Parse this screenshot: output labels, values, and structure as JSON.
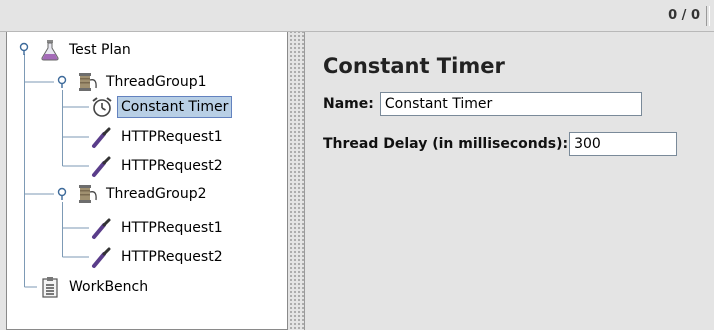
{
  "toolbar": {
    "counter": "0 / 0"
  },
  "tree": {
    "nodes": [
      {
        "label": "Test Plan",
        "icon": "flask-icon"
      },
      {
        "label": "ThreadGroup1",
        "icon": "spool-icon"
      },
      {
        "label": "Constant Timer",
        "icon": "timer-icon",
        "selected": true
      },
      {
        "label": "HTTPRequest1",
        "icon": "pipette-icon"
      },
      {
        "label": "HTTPRequest2",
        "icon": "pipette-icon"
      },
      {
        "label": "ThreadGroup2",
        "icon": "spool-icon"
      },
      {
        "label": "HTTPRequest1",
        "icon": "pipette-icon"
      },
      {
        "label": "HTTPRequest2",
        "icon": "pipette-icon"
      },
      {
        "label": "WorkBench",
        "icon": "clipboard-icon"
      }
    ]
  },
  "detail": {
    "title": "Constant Timer",
    "name_label": "Name:",
    "name_value": "Constant Timer",
    "delay_label": "Thread Delay (in milliseconds):",
    "delay_value": "300"
  },
  "colors": {
    "selection_bg": "#b8cfe5",
    "selection_border": "#6382bf",
    "panel_bg": "#e4e4e4",
    "tree_bg": "#ffffff"
  }
}
